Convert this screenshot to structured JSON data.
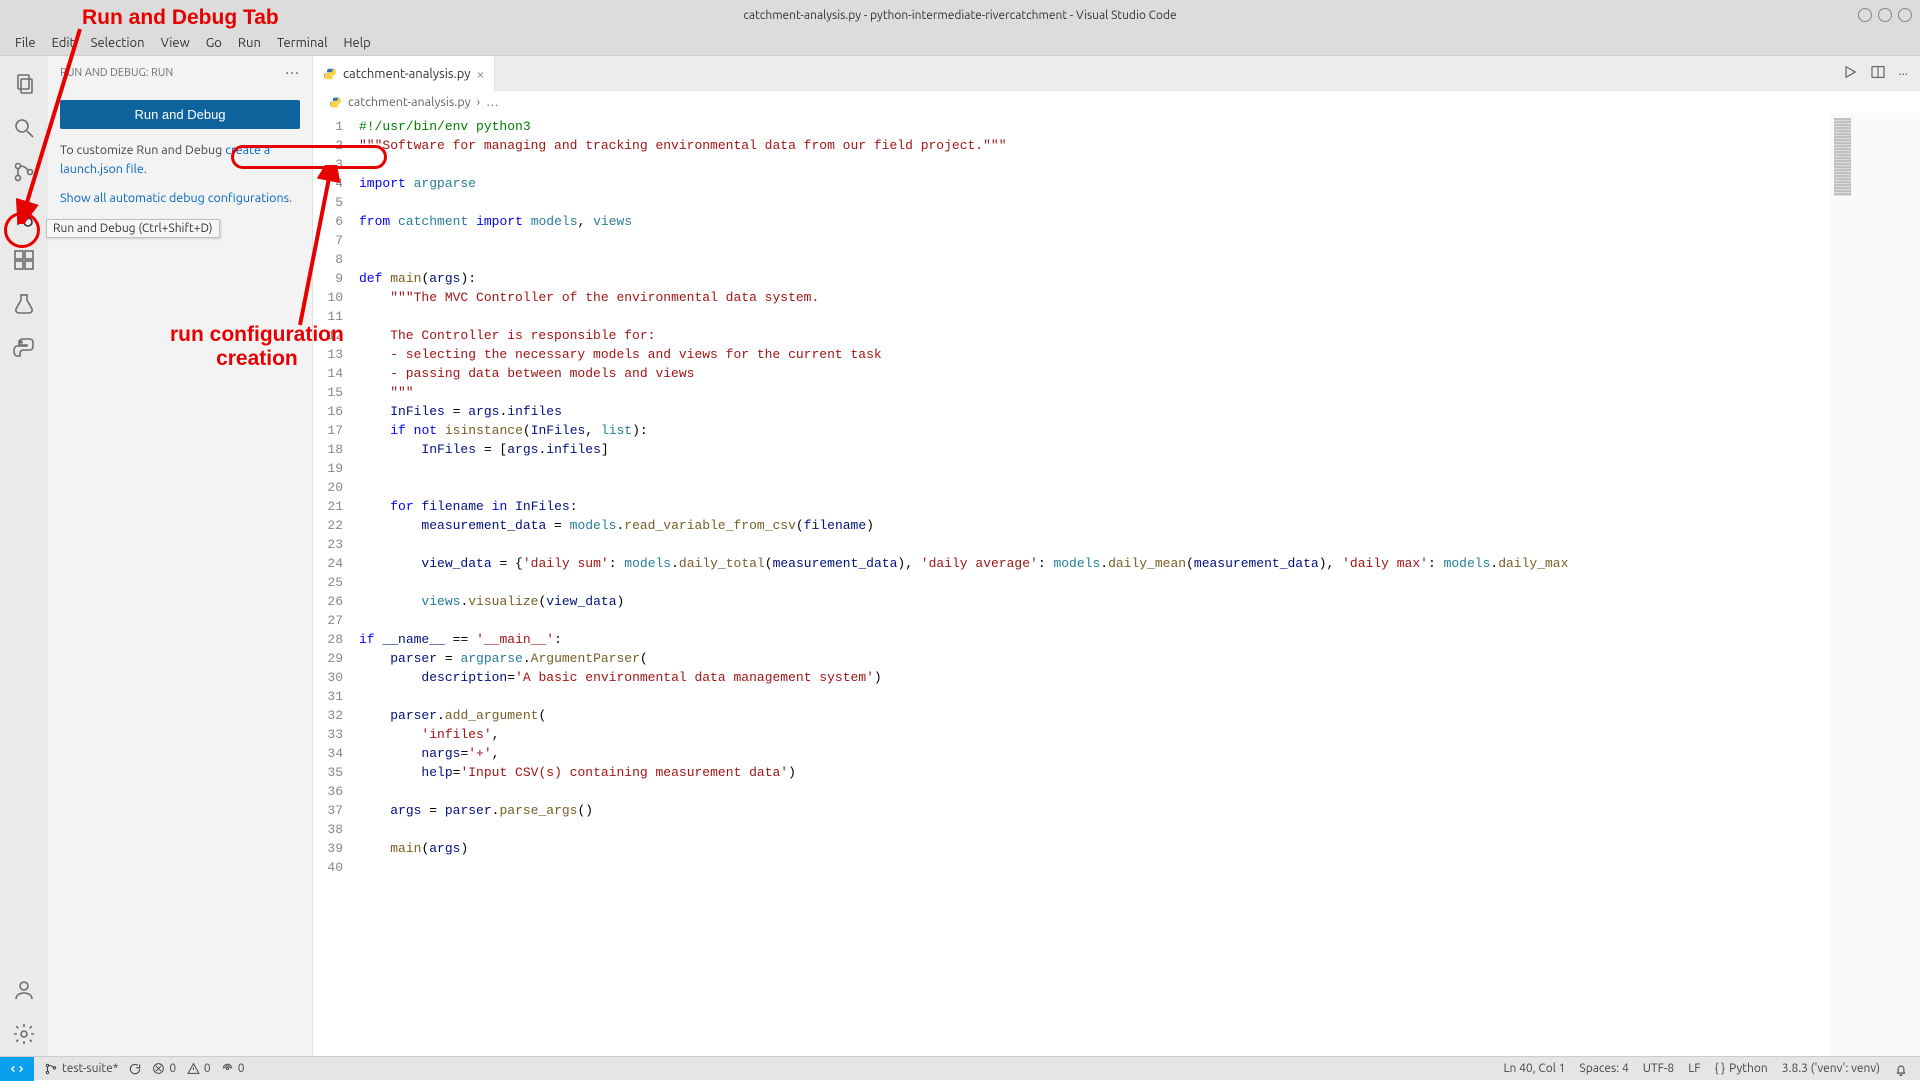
{
  "window": {
    "title": "catchment-analysis.py - python-intermediate-rivercatchment - Visual Studio Code"
  },
  "menu": [
    "File",
    "Edit",
    "Selection",
    "View",
    "Go",
    "Run",
    "Terminal",
    "Help"
  ],
  "activity": {
    "icons": [
      "files-icon",
      "search-icon",
      "source-control-icon",
      "run-debug-icon",
      "extensions-icon",
      "testing-icon",
      "python-env-icon"
    ],
    "bottom": [
      "account-icon",
      "gear-icon"
    ],
    "tooltip": "Run and Debug (Ctrl+Shift+D)"
  },
  "sidebar": {
    "header": "RUN AND DEBUG: RUN",
    "run_button": "Run and Debug",
    "desc_prefix": "To customize Run and Debug ",
    "desc_link": "create a launch.json file.",
    "auto_link": "Show all automatic debug configurations."
  },
  "tab": {
    "label": "catchment-analysis.py"
  },
  "breadcrumb": {
    "file": "catchment-analysis.py",
    "more": "…"
  },
  "code_lines": [
    {
      "n": 1,
      "html": "<span class='c-com'>#!/usr/bin/env python3</span>"
    },
    {
      "n": 2,
      "html": "<span class='c-str'>\"\"\"Software for managing and tracking environmental data from our field project.\"\"\"</span>"
    },
    {
      "n": 3,
      "html": ""
    },
    {
      "n": 4,
      "html": "<span class='c-kw'>import</span> <span class='c-mod'>argparse</span>"
    },
    {
      "n": 5,
      "html": ""
    },
    {
      "n": 6,
      "html": "<span class='c-kw'>from</span> <span class='c-mod'>catchment</span> <span class='c-kw'>import</span> <span class='c-mod'>models</span>, <span class='c-mod'>views</span>"
    },
    {
      "n": 7,
      "html": ""
    },
    {
      "n": 8,
      "html": ""
    },
    {
      "n": 9,
      "html": "<span class='c-def'>def</span> <span class='c-fn'>main</span>(<span class='c-var'>args</span>):"
    },
    {
      "n": 10,
      "html": "    <span class='c-str'>\"\"\"The MVC Controller of the environmental data system.</span>"
    },
    {
      "n": 11,
      "html": ""
    },
    {
      "n": 12,
      "html": "<span class='c-str'>    The Controller is responsible for:</span>"
    },
    {
      "n": 13,
      "html": "<span class='c-str'>    - selecting the necessary models and views for the current task</span>"
    },
    {
      "n": 14,
      "html": "<span class='c-str'>    - passing data between models and views</span>"
    },
    {
      "n": 15,
      "html": "<span class='c-str'>    \"\"\"</span>"
    },
    {
      "n": 16,
      "html": "    <span class='c-var'>InFiles</span> = <span class='c-var'>args</span>.<span class='c-var'>infiles</span>"
    },
    {
      "n": 17,
      "html": "    <span class='c-kw'>if</span> <span class='c-kw'>not</span> <span class='c-fn'>isinstance</span>(<span class='c-var'>InFiles</span>, <span class='c-mod'>list</span>):"
    },
    {
      "n": 18,
      "html": "        <span class='c-var'>InFiles</span> = [<span class='c-var'>args</span>.<span class='c-var'>infiles</span>]"
    },
    {
      "n": 19,
      "html": ""
    },
    {
      "n": 20,
      "html": ""
    },
    {
      "n": 21,
      "html": "    <span class='c-kw'>for</span> <span class='c-var'>filename</span> <span class='c-kw'>in</span> <span class='c-var'>InFiles</span>:"
    },
    {
      "n": 22,
      "html": "        <span class='c-var'>measurement_data</span> = <span class='c-mod'>models</span>.<span class='c-fn'>read_variable_from_csv</span>(<span class='c-var'>filename</span>)"
    },
    {
      "n": 23,
      "html": ""
    },
    {
      "n": 24,
      "html": "        <span class='c-var'>view_data</span> = {<span class='c-str'>'daily sum'</span>: <span class='c-mod'>models</span>.<span class='c-fn'>daily_total</span>(<span class='c-var'>measurement_data</span>), <span class='c-str'>'daily average'</span>: <span class='c-mod'>models</span>.<span class='c-fn'>daily_mean</span>(<span class='c-var'>measurement_data</span>), <span class='c-str'>'daily max'</span>: <span class='c-mod'>models</span>.<span class='c-fn'>daily_max</span>"
    },
    {
      "n": 25,
      "html": ""
    },
    {
      "n": 26,
      "html": "        <span class='c-mod'>views</span>.<span class='c-fn'>visualize</span>(<span class='c-var'>view_data</span>)"
    },
    {
      "n": 27,
      "html": ""
    },
    {
      "n": 28,
      "html": "<span class='c-kw'>if</span> <span class='c-var'>__name__</span> == <span class='c-str'>'__main__'</span>:"
    },
    {
      "n": 29,
      "html": "    <span class='c-var'>parser</span> = <span class='c-mod'>argparse</span>.<span class='c-fn'>ArgumentParser</span>("
    },
    {
      "n": 30,
      "html": "        <span class='c-var'>description</span>=<span class='c-str'>'A basic environmental data management system'</span>)"
    },
    {
      "n": 31,
      "html": ""
    },
    {
      "n": 32,
      "html": "    <span class='c-var'>parser</span>.<span class='c-fn'>add_argument</span>("
    },
    {
      "n": 33,
      "html": "        <span class='c-str'>'infiles'</span>,"
    },
    {
      "n": 34,
      "html": "        <span class='c-var'>nargs</span>=<span class='c-str'>'+'</span>,"
    },
    {
      "n": 35,
      "html": "        <span class='c-var'>help</span>=<span class='c-str'>'Input CSV(s) containing measurement data'</span>)"
    },
    {
      "n": 36,
      "html": ""
    },
    {
      "n": 37,
      "html": "    <span class='c-var'>args</span> = <span class='c-var'>parser</span>.<span class='c-fn'>parse_args</span>()"
    },
    {
      "n": 38,
      "html": ""
    },
    {
      "n": 39,
      "html": "    <span class='c-fn'>main</span>(<span class='c-var'>args</span>)"
    },
    {
      "n": 40,
      "html": ""
    }
  ],
  "status": {
    "branch": "test-suite*",
    "sync": "⟲",
    "errors": "0",
    "warnings": "0",
    "ports": "0",
    "ln": "Ln 40, Col 1",
    "spaces": "Spaces: 4",
    "enc": "UTF-8",
    "eol": "LF",
    "lang": "Python",
    "interp": "3.8.3 ('venv': venv)",
    "bell": "♪"
  },
  "annotations": {
    "top_label": "Run and Debug Tab",
    "bottom_label1": "run configuration",
    "bottom_label2": "creation"
  }
}
